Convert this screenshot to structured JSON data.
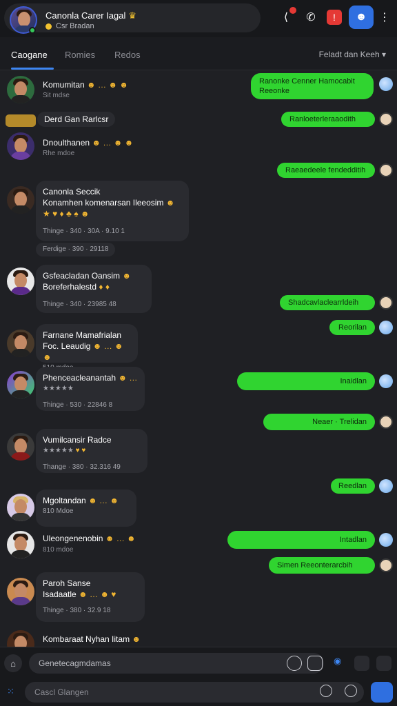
{
  "header": {
    "title": "Canonla Carer Iagal",
    "subtitle": "Csr Bradan"
  },
  "tabs": [
    {
      "label": "Caogane"
    },
    {
      "label": "Romies"
    },
    {
      "label": "Redos"
    }
  ],
  "tab_dropdown": "Feladt dan Keeh",
  "messages": [
    {
      "name": "Komumitan",
      "sub": "Sit mdse"
    },
    {
      "name": "Derd Gan Rarlcsr"
    },
    {
      "name": "Dnoulthanen",
      "sub": "Rhe mdoe"
    },
    {
      "title": "Canonla Seccik",
      "text": "Konamhen komenarsan Ileeosim",
      "meta1": "Thinge · 340 · 30A · 9.10 1",
      "meta2": "Ferdige · 390 · 29118"
    },
    {
      "title": "Gsfeacladan Oansim",
      "text": "Boreferhalestd",
      "meta1": "Thinge · 340 · 23985 48"
    },
    {
      "title": "Farnane Mamafrialan",
      "text": "Foc. Leaudig",
      "sub": "510 mdoe"
    },
    {
      "title": "Phenceacleanantah",
      "meta1": "Thinge · 530 · 22846 8"
    },
    {
      "title": "Vumilcansir Radce",
      "meta1": "Thange · 380 · 32.316 49"
    },
    {
      "name": "Mgoltandan",
      "sub": "810 Mdoe"
    },
    {
      "name": "Uleongenenobin",
      "sub": "810 mdoe"
    },
    {
      "title": "Paroh Sanse",
      "text": "Isadaatle",
      "meta1": "Thinge · 380 · 32.9 18"
    },
    {
      "name": "Kombaraat Nyhan Iitam"
    }
  ],
  "outgoing": [
    {
      "text": "Ranonke Cenner Hamocabit Reeonke"
    },
    {
      "text": "Ranloeterleraaodith"
    },
    {
      "text": "Raeaedeele fendedditih"
    },
    {
      "text": "Shadcavlaclearrldeih"
    },
    {
      "text": "Reorilan"
    },
    {
      "text": "Inaidlan"
    },
    {
      "text": "Neaer · Trelidan"
    },
    {
      "text": "Reedlan"
    },
    {
      "text": "Intadlan"
    },
    {
      "text": "Simen Reeonterarcbih"
    }
  ],
  "composer": {
    "placeholder1": "Genetecagmdamas",
    "placeholder2": "Cascl Glangen"
  },
  "colors": {
    "accent": "#2f6fe0",
    "outgoing_bubble": "#30d430",
    "background": "#1f2024"
  }
}
